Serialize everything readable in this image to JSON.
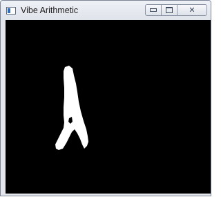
{
  "window": {
    "title": "Vibe Arithmetic"
  },
  "icons": {
    "app": "app-window-icon",
    "minimize": "minimize-icon",
    "maximize": "maximize-icon",
    "close": "close-icon"
  },
  "controls": {
    "close_glyph": "✕"
  },
  "colors": {
    "canvas_background": "#000000",
    "foreground_mask": "#ffffff"
  }
}
